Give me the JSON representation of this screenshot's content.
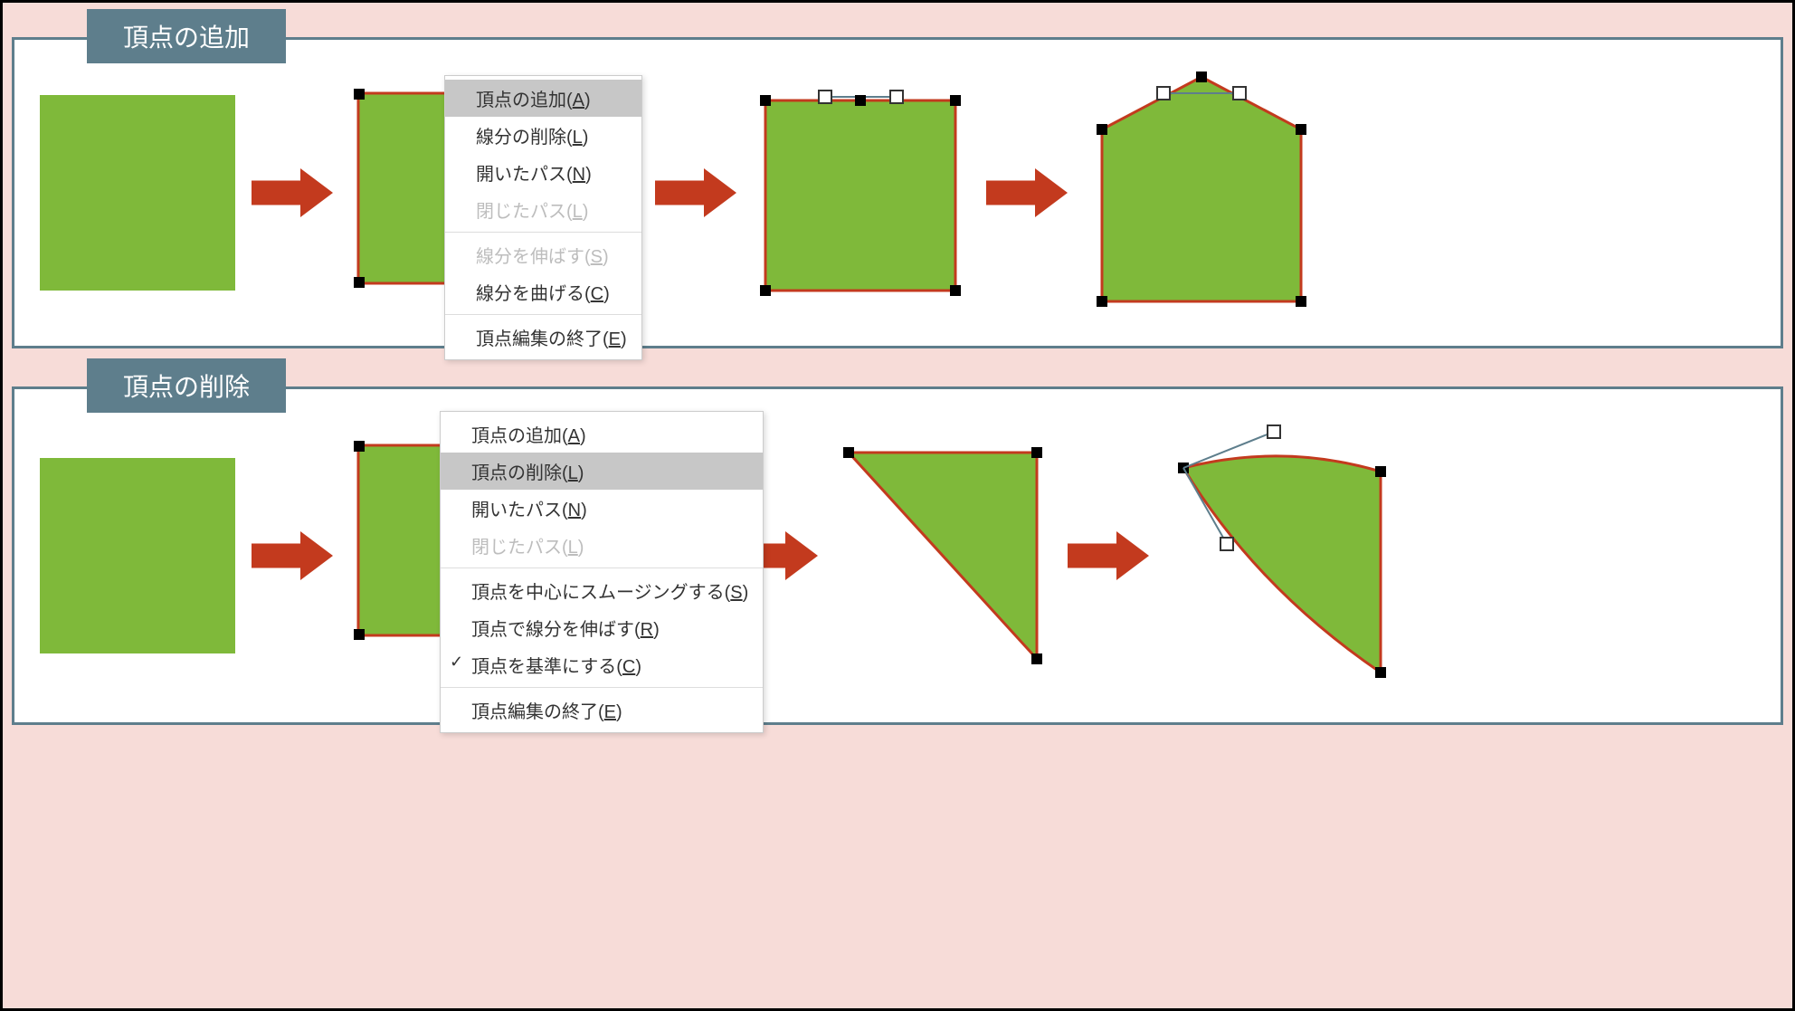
{
  "sections": {
    "add": {
      "title": "頂点の追加",
      "menu": {
        "items": [
          {
            "text": "頂点の追加",
            "mn": "A",
            "state": "sel"
          },
          {
            "text": "線分の削除",
            "mn": "L",
            "state": ""
          },
          {
            "text": "開いたパス",
            "mn": "N",
            "state": ""
          },
          {
            "text": "閉じたパス",
            "mn": "L",
            "state": "dis"
          },
          {
            "text": "線分を伸ばす",
            "mn": "S",
            "state": "dis"
          },
          {
            "text": "線分を曲げる",
            "mn": "C",
            "state": ""
          },
          {
            "text": "頂点編集の終了",
            "mn": "E",
            "state": ""
          }
        ],
        "seps": [
          3,
          4
        ]
      }
    },
    "del": {
      "title": "頂点の削除",
      "menu": {
        "items": [
          {
            "text": "頂点の追加",
            "mn": "A",
            "state": ""
          },
          {
            "text": "頂点の削除",
            "mn": "L",
            "state": "sel"
          },
          {
            "text": "開いたパス",
            "mn": "N",
            "state": ""
          },
          {
            "text": "閉じたパス",
            "mn": "L",
            "state": "dis"
          },
          {
            "text": "頂点を中心にスムージングする",
            "mn": "S",
            "state": ""
          },
          {
            "text": "頂点で線分を伸ばす",
            "mn": "R",
            "state": ""
          },
          {
            "text": "頂点を基準にする",
            "mn": "C",
            "state": "",
            "checked": true
          },
          {
            "text": "頂点編集の終了",
            "mn": "E",
            "state": ""
          }
        ],
        "seps": [
          3,
          6
        ]
      }
    }
  },
  "colors": {
    "fill": "#7fb93a",
    "outline": "#c33a1e",
    "arrow": "#c33a1e",
    "titleBg": "#5e7e8c"
  }
}
